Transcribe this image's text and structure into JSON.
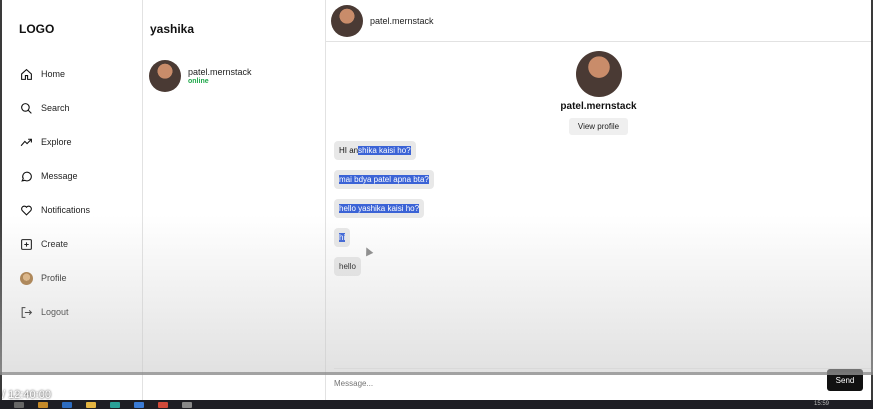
{
  "sidebar": {
    "logo": "LOGO",
    "items": [
      {
        "label": "Home",
        "icon": "home-icon"
      },
      {
        "label": "Search",
        "icon": "search-icon"
      },
      {
        "label": "Explore",
        "icon": "trending-icon"
      },
      {
        "label": "Message",
        "icon": "chat-bubble-icon"
      },
      {
        "label": "Notifications",
        "icon": "heart-icon"
      },
      {
        "label": "Create",
        "icon": "plus-square-icon"
      },
      {
        "label": "Profile",
        "icon": "avatar"
      },
      {
        "label": "Logout",
        "icon": "logout-icon"
      }
    ]
  },
  "conversations": {
    "title": "yashika",
    "items": [
      {
        "name": "patel.mernstack",
        "status": "online"
      }
    ]
  },
  "chat": {
    "header_name": "patel.mernstack",
    "profile_name": "patel.mernstack",
    "view_profile_label": "View profile",
    "messages": [
      {
        "text_plain": "HI an",
        "text_selected": "shika kaisi ho?"
      },
      {
        "text_plain": "",
        "text_selected": "mai bdya patel apna bta?"
      },
      {
        "text_plain": "",
        "text_selected": "hello yashika kaisi ho?"
      },
      {
        "text_plain": "",
        "text_selected": "hi"
      },
      {
        "text_plain": "hello",
        "text_selected": ""
      }
    ],
    "input_placeholder": "Message...",
    "send_label": "Send"
  },
  "video": {
    "time_label": "/ 12:40:00"
  },
  "taskbar": {
    "clock": "15:59"
  },
  "colors": {
    "selection": "#3b63d6",
    "online": "#1fa84a",
    "send_button": "#111111"
  }
}
